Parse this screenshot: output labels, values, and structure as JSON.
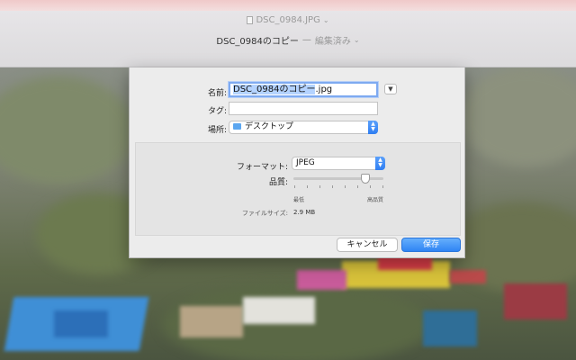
{
  "window": {
    "document_tab": "DSC_0984.JPG",
    "document_tab_chevron": "⌄",
    "title": "DSC_0984のコピー",
    "title_separator": "—",
    "status": "編集済み",
    "status_chevron": "⌄"
  },
  "save_sheet": {
    "name_label": "名前:",
    "name_value_selected": "DSC_0984のコピー",
    "name_value_ext": ".jpg",
    "tags_label": "タグ:",
    "tags_value": "",
    "location_label": "場所:",
    "location_value": "デスクトップ",
    "location_icon": "folder-icon",
    "expand_icon": "chevron-down-icon",
    "format_label": "フォーマット:",
    "format_value": "JPEG",
    "quality_label": "品質:",
    "quality_level": 0.8,
    "quality_min_label": "最低",
    "quality_max_label": "高品質",
    "filesize_label": "ファイルサイズ:",
    "filesize_value": "2.9 MB",
    "cancel_label": "キャンセル",
    "save_label": "保存",
    "accent_color": "#2f84f4"
  }
}
